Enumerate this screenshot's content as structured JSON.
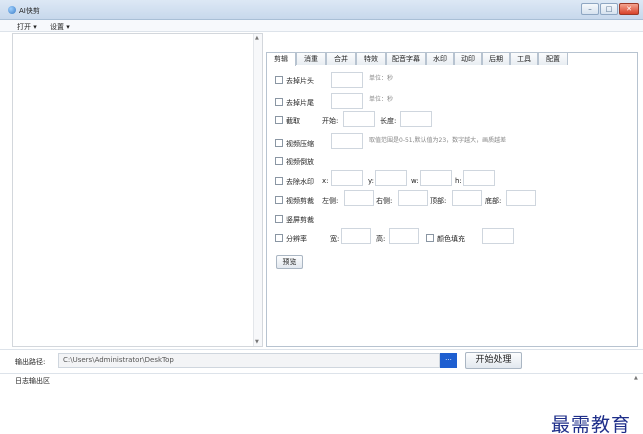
{
  "window": {
    "title": "AI快剪",
    "min": "–",
    "max": "□",
    "close": "✕"
  },
  "menu": [
    {
      "label": "打开 ▾"
    },
    {
      "label": "设置 ▾"
    }
  ],
  "tabs": [
    {
      "label": "剪辑",
      "active": true
    },
    {
      "label": "消重"
    },
    {
      "label": "合并"
    },
    {
      "label": "特效"
    },
    {
      "label": "配音字幕"
    },
    {
      "label": "水印"
    },
    {
      "label": "动印"
    },
    {
      "label": "后期"
    },
    {
      "label": "工具"
    },
    {
      "label": "配置"
    }
  ],
  "options": {
    "trim_head": {
      "label": "去掉片头",
      "unit": "单位：秒"
    },
    "trim_tail": {
      "label": "去掉片尾",
      "unit": "单位：秒"
    },
    "cut": {
      "label": "截取",
      "start": "开始:",
      "length": "长度:"
    },
    "compress": {
      "label": "视频压缩",
      "hint": "取值范围是0-51,默认值为23，数字越大，画质越差"
    },
    "reverse": {
      "label": "视频倒放"
    },
    "remove_watermark": {
      "label": "去除水印",
      "x": "x:",
      "y": "y:",
      "w": "w:",
      "h": "h:"
    },
    "crop": {
      "label": "视频剪裁",
      "left": "左侧:",
      "right": "右侧:",
      "top": "顶部:",
      "bottom": "底部:"
    },
    "vertical_crop": {
      "label": "竖屏剪裁"
    },
    "resolution": {
      "label": "分辨率",
      "width": "宽:",
      "height": "高:",
      "fill": "颜色填充"
    }
  },
  "preview_button": "预览",
  "output": {
    "label": "输出路径:",
    "path": "C:\\Users\\Administrator\\DeskTop",
    "browse": "...",
    "start_button": "开始处理"
  },
  "log": {
    "label": "日志输出区"
  },
  "watermark": "最需教育"
}
